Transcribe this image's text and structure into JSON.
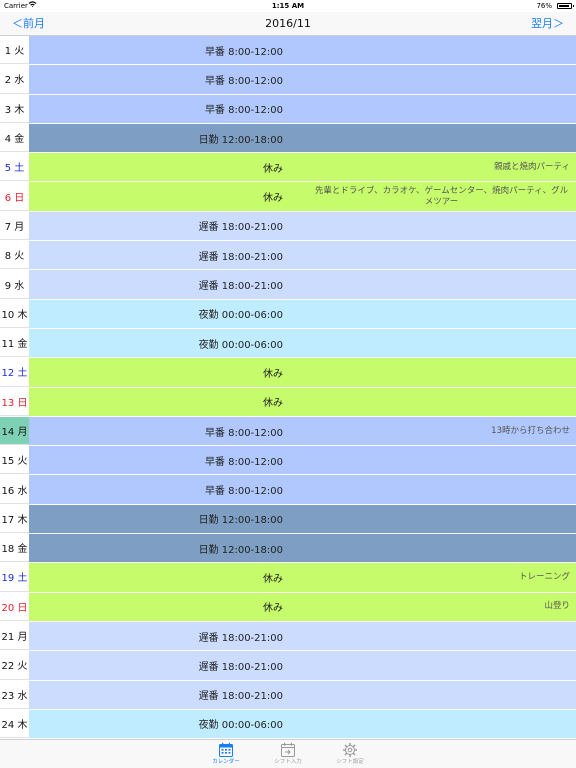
{
  "status_bar": {
    "carrier": "Carrier",
    "time": "1:15 AM",
    "battery": "76%",
    "battery_level": 0.76
  },
  "nav": {
    "prev": "＜前月",
    "title": "2016/11",
    "next": "翌月＞"
  },
  "colors": {
    "early": "#b0c8fd",
    "day": "#7e9fc3",
    "off": "#c6fb6b",
    "late": "#cbdcff",
    "night": "#bfecff",
    "accent": "#1a7cf5",
    "today": "#7fd1b5"
  },
  "rows": [
    {
      "day": "1 火",
      "shift": "早番 8:00-12:00",
      "memo": "",
      "type": "early",
      "dow": "wd"
    },
    {
      "day": "2 水",
      "shift": "早番 8:00-12:00",
      "memo": "",
      "type": "early",
      "dow": "wd"
    },
    {
      "day": "3 木",
      "shift": "早番 8:00-12:00",
      "memo": "",
      "type": "early",
      "dow": "wd"
    },
    {
      "day": "4 金",
      "shift": "日勤 12:00-18:00",
      "memo": "",
      "type": "day",
      "dow": "wd"
    },
    {
      "day": "5 土",
      "shift": "休み",
      "memo": "親戚と焼肉パーティ",
      "type": "off",
      "dow": "sat"
    },
    {
      "day": "6 日",
      "shift": "休み",
      "memo": "先輩とドライブ、カラオケ、ゲームセンター、焼肉パーティ、グルメツアー",
      "type": "off",
      "dow": "sun",
      "wrap": true
    },
    {
      "day": "7 月",
      "shift": "遅番 18:00-21:00",
      "memo": "",
      "type": "late",
      "dow": "wd"
    },
    {
      "day": "8 火",
      "shift": "遅番 18:00-21:00",
      "memo": "",
      "type": "late",
      "dow": "wd"
    },
    {
      "day": "9 水",
      "shift": "遅番 18:00-21:00",
      "memo": "",
      "type": "late",
      "dow": "wd"
    },
    {
      "day": "10 木",
      "shift": "夜勤 00:00-06:00",
      "memo": "",
      "type": "night",
      "dow": "wd"
    },
    {
      "day": "11 金",
      "shift": "夜勤 00:00-06:00",
      "memo": "",
      "type": "night",
      "dow": "wd"
    },
    {
      "day": "12 土",
      "shift": "休み",
      "memo": "",
      "type": "off",
      "dow": "sat"
    },
    {
      "day": "13 日",
      "shift": "休み",
      "memo": "",
      "type": "off",
      "dow": "sun"
    },
    {
      "day": "14 月",
      "shift": "早番 8:00-12:00",
      "memo": "13時から打ち合わせ",
      "type": "early",
      "dow": "wd",
      "today": true
    },
    {
      "day": "15 火",
      "shift": "早番 8:00-12:00",
      "memo": "",
      "type": "early",
      "dow": "wd"
    },
    {
      "day": "16 水",
      "shift": "早番 8:00-12:00",
      "memo": "",
      "type": "early",
      "dow": "wd"
    },
    {
      "day": "17 木",
      "shift": "日勤 12:00-18:00",
      "memo": "",
      "type": "day",
      "dow": "wd"
    },
    {
      "day": "18 金",
      "shift": "日勤 12:00-18:00",
      "memo": "",
      "type": "day",
      "dow": "wd"
    },
    {
      "day": "19 土",
      "shift": "休み",
      "memo": "トレーニング",
      "type": "off",
      "dow": "sat"
    },
    {
      "day": "20 日",
      "shift": "休み",
      "memo": "山登り",
      "type": "off",
      "dow": "sun"
    },
    {
      "day": "21 月",
      "shift": "遅番 18:00-21:00",
      "memo": "",
      "type": "late",
      "dow": "wd"
    },
    {
      "day": "22 火",
      "shift": "遅番 18:00-21:00",
      "memo": "",
      "type": "late",
      "dow": "wd"
    },
    {
      "day": "23 水",
      "shift": "遅番 18:00-21:00",
      "memo": "",
      "type": "late",
      "dow": "wd"
    },
    {
      "day": "24 木",
      "shift": "夜勤 00:00-06:00",
      "memo": "",
      "type": "night",
      "dow": "wd"
    }
  ],
  "tabs": [
    {
      "label": "カレンダー",
      "icon": "calendar-icon",
      "active": true
    },
    {
      "label": "シフト入力",
      "icon": "shift-input-icon",
      "active": false
    },
    {
      "label": "シフト設定",
      "icon": "gear-icon",
      "active": false
    }
  ]
}
